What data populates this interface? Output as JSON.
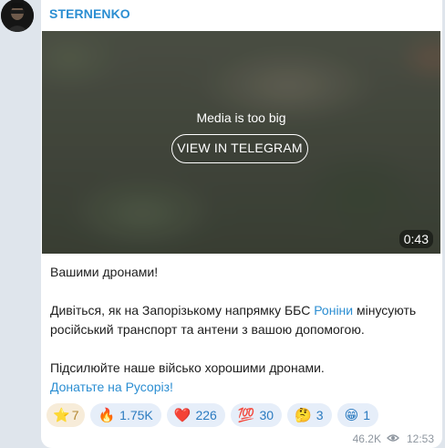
{
  "channel": {
    "name": "STERNENKO"
  },
  "media": {
    "notice": "Media is too big",
    "button_label": "VIEW IN TELEGRAM",
    "duration": "0:43"
  },
  "post": {
    "line1": "Вашими дронами!",
    "line2_before": "Дивіться, як на Запорізькому напрямку ББС ",
    "line2_link": "Роніни",
    "line2_after": " мінусують російський транспорт та антени з вашою допомогою.",
    "line3": "Підсилюйте наше військо хорошими дронами.",
    "line4_link": "Донатьте на Русоріз!"
  },
  "reactions": [
    {
      "emoji": "⭐",
      "count": "7",
      "kind": "star",
      "icon": "star-icon"
    },
    {
      "emoji": "🔥",
      "count": "1.75K",
      "kind": "normal",
      "icon": "fire-icon"
    },
    {
      "emoji": "❤️",
      "count": "226",
      "kind": "normal",
      "icon": "heart-icon"
    },
    {
      "emoji": "💯",
      "count": "30",
      "kind": "normal",
      "icon": "hundred-icon"
    },
    {
      "emoji": "🤔",
      "count": "3",
      "kind": "normal",
      "icon": "thinking-face-icon"
    },
    {
      "emoji": "😁",
      "count": "1",
      "kind": "normal",
      "icon": "grin-face-icon"
    }
  ],
  "meta": {
    "views": "46.2K",
    "time": "12:53"
  },
  "colors": {
    "accent": "#2b8ed2",
    "background": "#dfe5ec",
    "reaction_bg": "#e6eef9",
    "star_bg": "#f7ecd9"
  }
}
